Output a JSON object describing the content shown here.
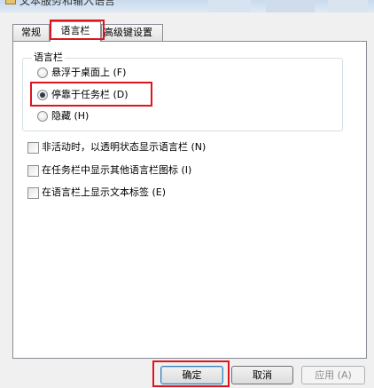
{
  "window": {
    "title": "文本服务和输入语言"
  },
  "tabs": [
    {
      "label": "常规",
      "selected": false
    },
    {
      "label": "语言栏",
      "selected": true
    },
    {
      "label": "高级键设置",
      "selected": false
    }
  ],
  "language_bar_group": {
    "legend": "语言栏",
    "options": [
      {
        "label": "悬浮于桌面上 (F)",
        "checked": false
      },
      {
        "label": "停靠于任务栏 (D)",
        "checked": true
      },
      {
        "label": "隐藏 (H)",
        "checked": false
      }
    ]
  },
  "checkboxes": [
    {
      "label": "非活动时，以透明状态显示语言栏 (N)",
      "checked": false
    },
    {
      "label": "在任务栏中显示其他语言栏图标 (I)",
      "checked": false
    },
    {
      "label": "在语言栏上显示文本标签 (E)",
      "checked": false
    }
  ],
  "buttons": {
    "ok": "确定",
    "cancel": "取消",
    "apply": "应用 (A)"
  },
  "colors": {
    "highlight": "#e0141e",
    "panel_border": "#898c95",
    "background": "#f0f0f0"
  }
}
